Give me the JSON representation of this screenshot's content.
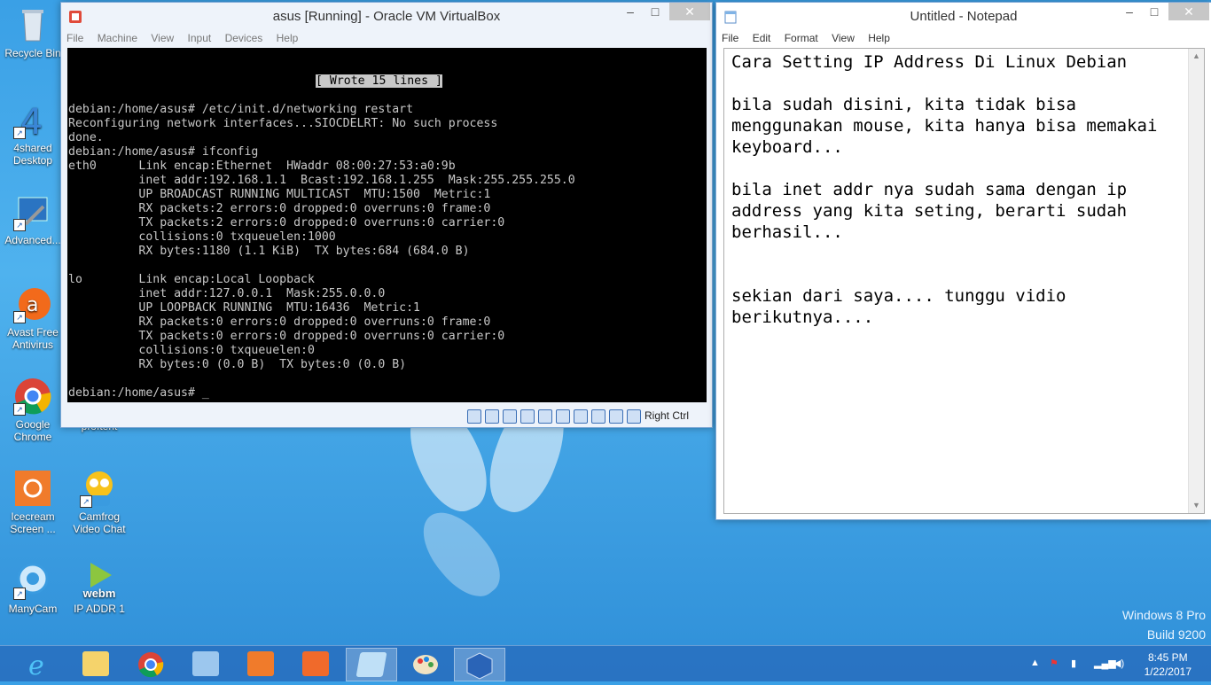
{
  "desktop": {
    "icons": [
      {
        "label": "Recycle Bin",
        "color": "#9fb3c8"
      },
      {
        "label": "4shared Desktop",
        "color": "#3a86d6"
      },
      {
        "label": "Advanced...",
        "color": "#2a74c2"
      },
      {
        "label": "Avast Free Antivirus",
        "color": "#f26a1b"
      },
      {
        "label": "Google Chrome",
        "color": "#db4437"
      },
      {
        "label": "proftent",
        "color": "#2d86d8"
      },
      {
        "label": "Icecream Screen ...",
        "color": "#f07b2b"
      },
      {
        "label": "Camfrog Video Chat",
        "color": "#6bb42b"
      },
      {
        "label": "ManyCam",
        "color": "#3a9be0"
      },
      {
        "label": "IP ADDR 1",
        "color": "#8cc63f"
      }
    ],
    "webm_label": "webm",
    "watermark": {
      "line1": "Windows 8 Pro",
      "line2": "Build 9200"
    }
  },
  "vbox": {
    "title": "asus [Running] - Oracle VM VirtualBox",
    "menu": [
      "File",
      "Machine",
      "View",
      "Input",
      "Devices",
      "Help"
    ],
    "console_banner": "[ Wrote 15 lines ]",
    "console_lines": [
      "debian:/home/asus# /etc/init.d/networking restart",
      "Reconfiguring network interfaces...SIOCDELRT: No such process",
      "done.",
      "debian:/home/asus# ifconfig",
      "eth0      Link encap:Ethernet  HWaddr 08:00:27:53:a0:9b",
      "          inet addr:192.168.1.1  Bcast:192.168.1.255  Mask:255.255.255.0",
      "          UP BROADCAST RUNNING MULTICAST  MTU:1500  Metric:1",
      "          RX packets:2 errors:0 dropped:0 overruns:0 frame:0",
      "          TX packets:2 errors:0 dropped:0 overruns:0 carrier:0",
      "          collisions:0 txqueuelen:1000",
      "          RX bytes:1180 (1.1 KiB)  TX bytes:684 (684.0 B)",
      "",
      "lo        Link encap:Local Loopback",
      "          inet addr:127.0.0.1  Mask:255.0.0.0",
      "          UP LOOPBACK RUNNING  MTU:16436  Metric:1",
      "          RX packets:0 errors:0 dropped:0 overruns:0 frame:0",
      "          TX packets:0 errors:0 dropped:0 overruns:0 carrier:0",
      "          collisions:0 txqueuelen:0",
      "          RX bytes:0 (0.0 B)  TX bytes:0 (0.0 B)",
      "",
      "debian:/home/asus# _"
    ],
    "status_right": "Right Ctrl"
  },
  "notepad": {
    "title": "Untitled - Notepad",
    "menu": [
      "File",
      "Edit",
      "Format",
      "View",
      "Help"
    ],
    "text": "Cara Setting IP Address Di Linux Debian\n\nbila sudah disini, kita tidak bisa menggunakan mouse, kita hanya bisa memakai keyboard...\n\nbila inet addr nya sudah sama dengan ip address yang kita seting, berarti sudah berhasil...\n\n\nsekian dari saya.... tunggu vidio berikutnya...."
  },
  "taskbar": {
    "apps": [
      "internet-explorer",
      "file-explorer",
      "google-chrome",
      "control-panel",
      "icecream-recorder",
      "icecream-screenshot",
      "notepad",
      "paint",
      "virtualbox"
    ],
    "time": "8:45 PM",
    "date": "1/22/2017"
  }
}
